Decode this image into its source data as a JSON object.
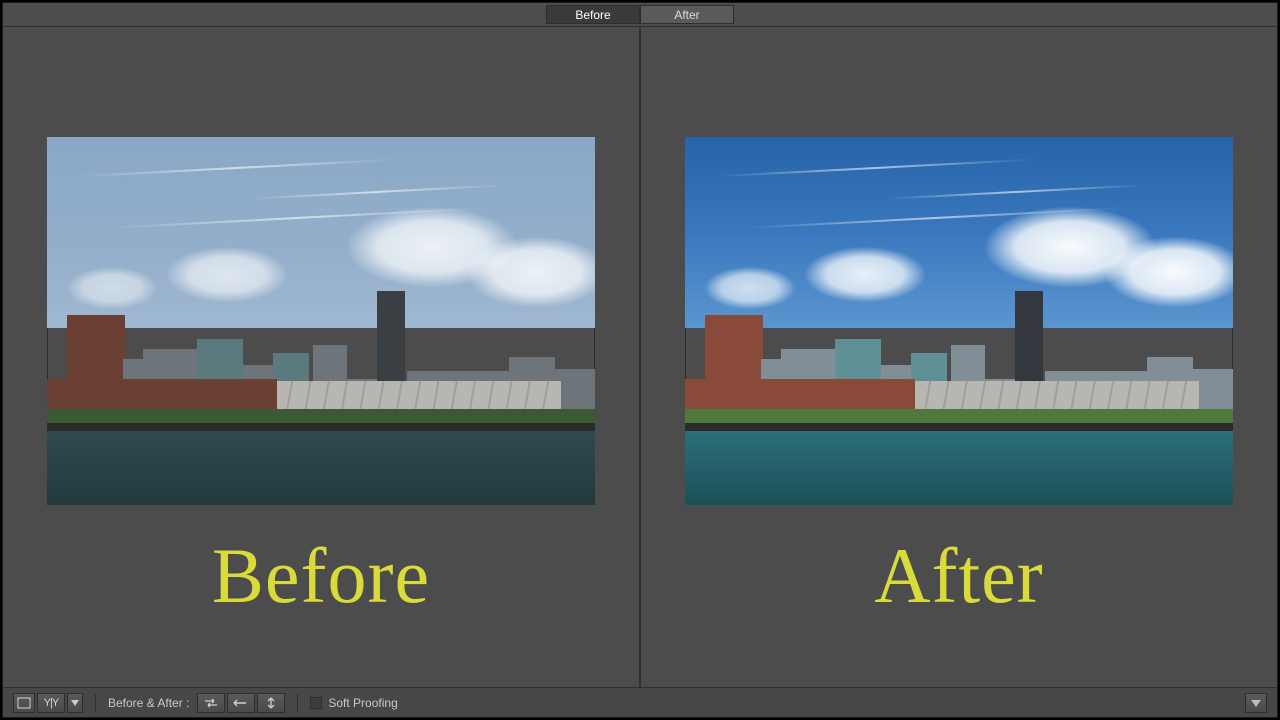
{
  "top_tabs": {
    "before": "Before",
    "after": "After",
    "active": "before"
  },
  "labels": {
    "before": "Before",
    "after": "After"
  },
  "toolbar": {
    "before_after_label": "Before & After :",
    "soft_proofing_label": "Soft Proofing"
  },
  "colors": {
    "overlay_text": "#d8db3a"
  }
}
